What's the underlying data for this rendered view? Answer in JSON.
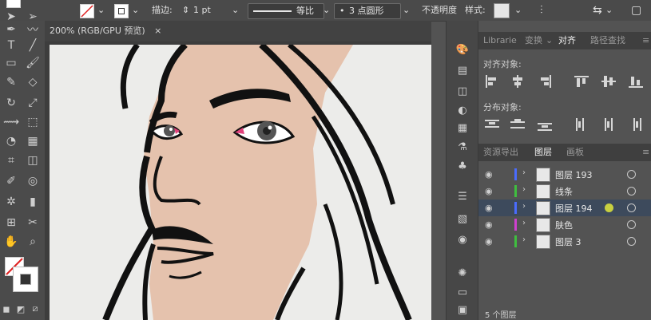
{
  "control_bar": {
    "stroke_label": "描边:",
    "stroke_weight": "1 pt",
    "stroke_profile": "等比",
    "brush": "3 点圆形",
    "opacity_label": "不透明度",
    "style_label": "样式:"
  },
  "document": {
    "tab_title": "200% (RGB/GPU 预览)"
  },
  "panels": {
    "top_tabs": [
      "Librarie",
      "变换",
      "对齐",
      "路径查找"
    ],
    "align_objects_label": "对齐对象:",
    "distribute_objects_label": "分布对象:",
    "layers_tabs": [
      "资源导出",
      "图层",
      "画板"
    ],
    "layers": [
      {
        "name": "图层 193",
        "color": "#4a6cff",
        "selected": false
      },
      {
        "name": "线条",
        "color": "#3fbf3f",
        "selected": false
      },
      {
        "name": "图层 194",
        "color": "#4a6cff",
        "selected": true
      },
      {
        "name": "肤色",
        "color": "#d040d0",
        "selected": false
      },
      {
        "name": "图层 3",
        "color": "#3fbf3f",
        "selected": false
      }
    ],
    "bottom_label": "5 个图层"
  },
  "colors": {
    "skin": "#e5c2ad",
    "line": "#111111",
    "artboard": "#ececea",
    "eye_pink": "#e0407a"
  }
}
